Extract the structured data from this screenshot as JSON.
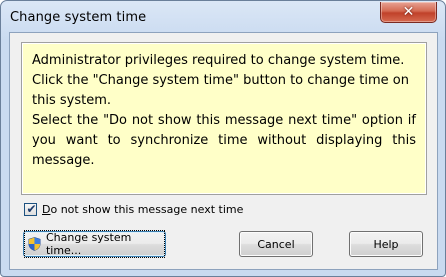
{
  "window": {
    "title": "Change system time",
    "close_symbol": "✕"
  },
  "message": {
    "line1": "Administrator privileges required to change system time.",
    "line2": "Click the \"Change system time\" button to change time on this system.",
    "line3": "Select the \"Do not show this message next time\" option if you want to synchronize time without displaying this message."
  },
  "checkbox": {
    "checked": true,
    "label_prefix": "D",
    "label_rest": "o not show this message next time"
  },
  "buttons": {
    "change_label": "Change system time...",
    "cancel_label": "Cancel",
    "help_label": "Help"
  },
  "icons": {
    "change_button_icon": "uac-shield-icon",
    "checkbox_mark": "check-icon"
  },
  "colors": {
    "message_background": "#ffffc8",
    "close_button": "#c0412a",
    "default_button_border": "#3c7fb1"
  }
}
